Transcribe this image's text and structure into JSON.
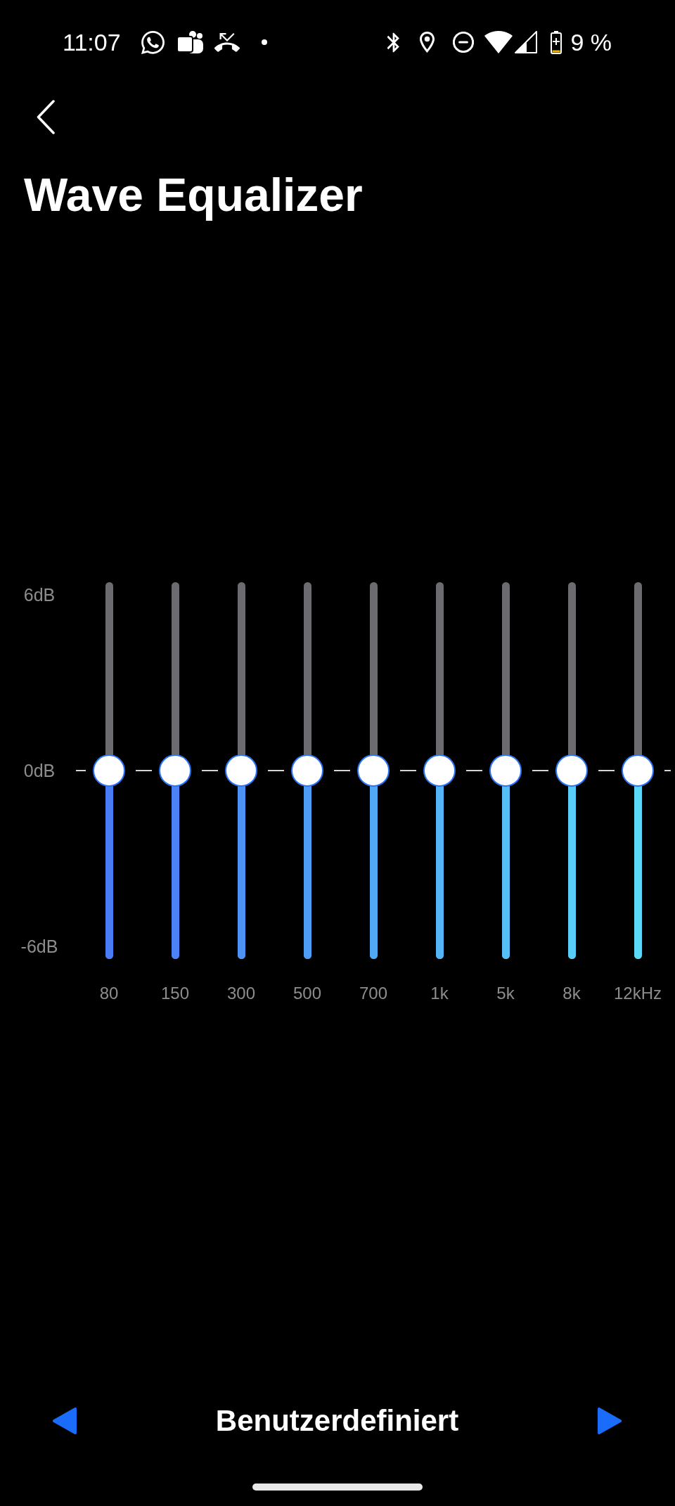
{
  "status_bar": {
    "time": "11:07",
    "battery": "9 %"
  },
  "header": {
    "title": "Wave Equalizer"
  },
  "equalizer": {
    "scale_labels": [
      "6dB",
      "0dB",
      "-6dB"
    ],
    "bands": [
      {
        "label": "80",
        "level": 0.5,
        "color": "#4a7cf8"
      },
      {
        "label": "150",
        "level": 0.5,
        "color": "#4b82f8"
      },
      {
        "label": "300",
        "level": 0.5,
        "color": "#4d93f5"
      },
      {
        "label": "500",
        "level": 0.5,
        "color": "#4f9cf5"
      },
      {
        "label": "700",
        "level": 0.5,
        "color": "#51a8f5"
      },
      {
        "label": "1k",
        "level": 0.5,
        "color": "#54b4f6"
      },
      {
        "label": "5k",
        "level": 0.5,
        "color": "#56bff6"
      },
      {
        "label": "8k",
        "level": 0.5,
        "color": "#58cdf8"
      },
      {
        "label": "12kHz",
        "level": 0.5,
        "color": "#5adaf8"
      }
    ]
  },
  "preset": {
    "name": "Benutzerdefiniert"
  }
}
